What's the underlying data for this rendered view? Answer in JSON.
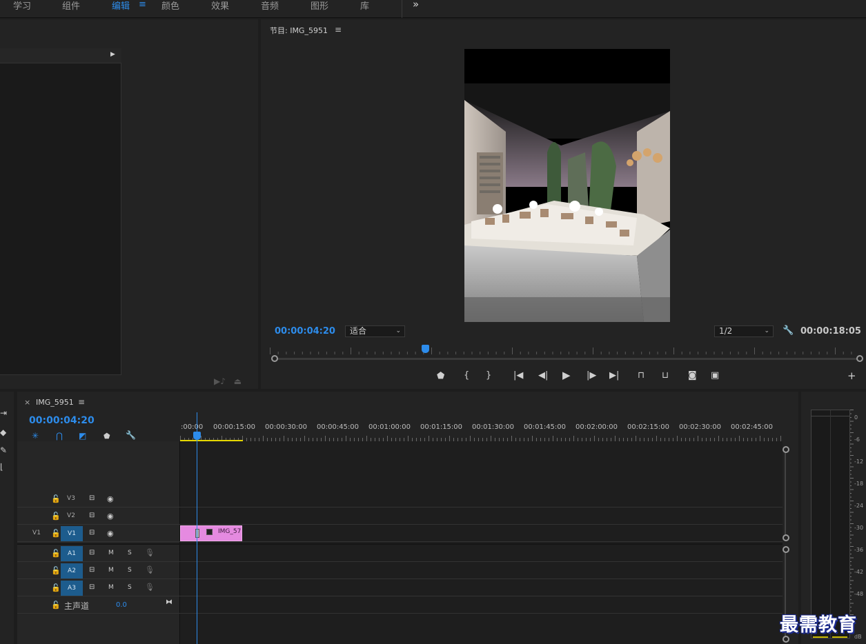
{
  "workspace_tabs": [
    {
      "label": "学习",
      "active": false
    },
    {
      "label": "组件",
      "active": false
    },
    {
      "label": "编辑",
      "active": true
    },
    {
      "label": "颜色",
      "active": false
    },
    {
      "label": "效果",
      "active": false
    },
    {
      "label": "音频",
      "active": false
    },
    {
      "label": "图形",
      "active": false
    },
    {
      "label": "库",
      "active": false
    }
  ],
  "workspace_menu_icon": "≡",
  "workspace_more_icon": "»",
  "program_monitor": {
    "title": "节目: IMG_5951",
    "menu_icon": "≡",
    "current_timecode": "00:00:04:20",
    "zoom_value": "适合",
    "resolution_value": "1/2",
    "duration_timecode": "00:00:18:05",
    "playhead_fraction": 0.257
  },
  "timeline": {
    "sequence_name": "IMG_5951",
    "close_icon": "×",
    "menu_icon": "≡",
    "current_timecode": "00:00:04:20",
    "ruler_labels": [
      ":00:00",
      "00:00:15:00",
      "00:00:30:00",
      "00:00:45:00",
      "00:01:00:00",
      "00:01:15:00",
      "00:01:30:00",
      "00:01:45:00",
      "00:02:00:00",
      "00:02:15:00",
      "00:02:30:00",
      "00:02:45:00"
    ],
    "video_tracks": [
      {
        "name": "V3",
        "source": ""
      },
      {
        "name": "V2",
        "source": ""
      },
      {
        "name": "V1",
        "source": "V1"
      }
    ],
    "audio_tracks": [
      {
        "name": "A1",
        "m": "M",
        "s": "S"
      },
      {
        "name": "A2",
        "m": "M",
        "s": "S"
      },
      {
        "name": "A3",
        "m": "M",
        "s": "S"
      }
    ],
    "master": {
      "label": "主声道",
      "value": "0.0"
    },
    "clip_name": "IMG_57",
    "clip_color": "#e58ae0"
  },
  "meter_scale": [
    "0",
    "-6",
    "-12",
    "-18",
    "-24",
    "-30",
    "-36",
    "-42",
    "-48",
    "dB"
  ],
  "watermark": "最需教育",
  "colors": {
    "accent": "#2d8ceb",
    "track_target": "#1d5c8d",
    "background": "#1d1d1d"
  }
}
